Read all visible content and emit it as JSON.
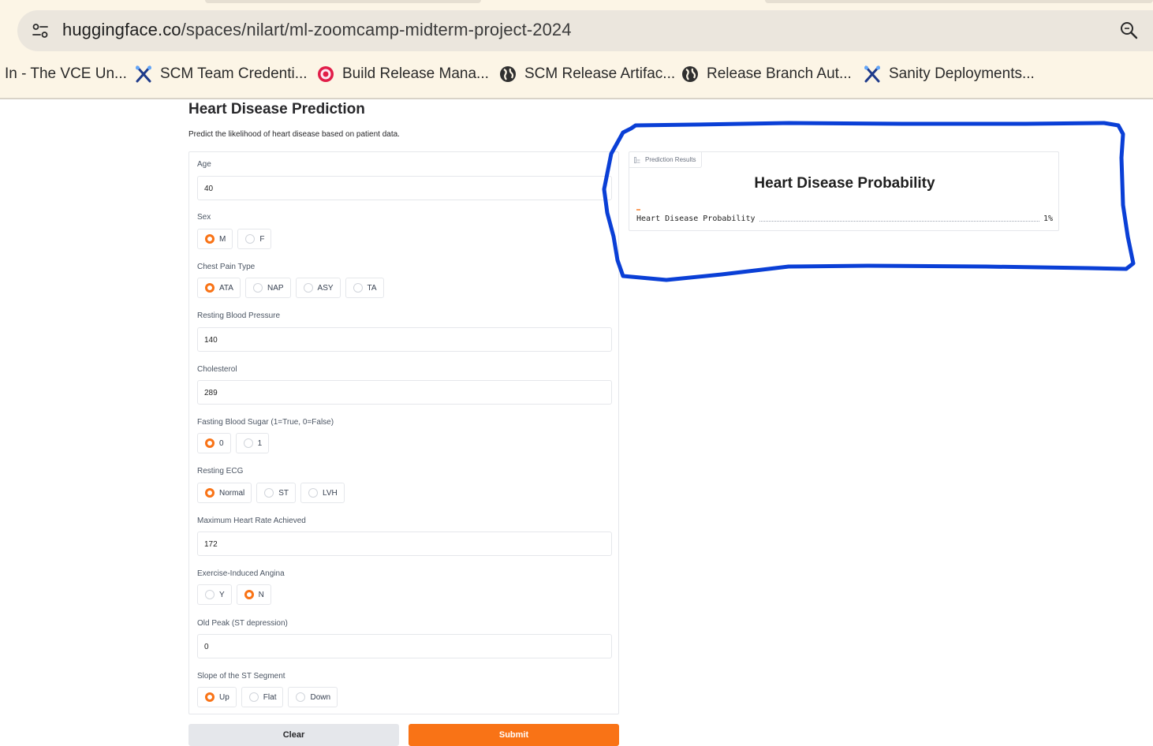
{
  "browser": {
    "url_host": "huggingface.co",
    "url_path": "/spaces/nilart/ml-zoomcamp-midterm-project-2024",
    "bookmarks": [
      {
        "label": "In - The VCE Un...",
        "icon": "none"
      },
      {
        "label": "SCM Team Credenti...",
        "icon": "crossed-tools-icon"
      },
      {
        "label": "Build Release Mana...",
        "icon": "lifebuoy-icon"
      },
      {
        "label": "SCM Release Artifac...",
        "icon": "globe-icon"
      },
      {
        "label": "Release Branch Aut...",
        "icon": "globe-icon"
      },
      {
        "label": "Sanity Deployments...",
        "icon": "crossed-tools-icon"
      }
    ]
  },
  "page": {
    "title": "Heart Disease Prediction",
    "description": "Predict the likelihood of heart disease based on patient data."
  },
  "form": {
    "age": {
      "label": "Age",
      "value": "40"
    },
    "sex": {
      "label": "Sex",
      "options": [
        "M",
        "F"
      ],
      "selected": "M"
    },
    "chest_pain": {
      "label": "Chest Pain Type",
      "options": [
        "ATA",
        "NAP",
        "ASY",
        "TA"
      ],
      "selected": "ATA"
    },
    "resting_bp": {
      "label": "Resting Blood Pressure",
      "value": "140"
    },
    "cholesterol": {
      "label": "Cholesterol",
      "value": "289"
    },
    "fasting_bs": {
      "label": "Fasting Blood Sugar (1=True, 0=False)",
      "options": [
        "0",
        "1"
      ],
      "selected": "0"
    },
    "resting_ecg": {
      "label": "Resting ECG",
      "options": [
        "Normal",
        "ST",
        "LVH"
      ],
      "selected": "Normal"
    },
    "max_hr": {
      "label": "Maximum Heart Rate Achieved",
      "value": "172"
    },
    "exercise_angina": {
      "label": "Exercise-Induced Angina",
      "options": [
        "Y",
        "N"
      ],
      "selected": "N"
    },
    "oldpeak": {
      "label": "Old Peak (ST depression)",
      "value": "0"
    },
    "st_slope": {
      "label": "Slope of the ST Segment",
      "options": [
        "Up",
        "Flat",
        "Down"
      ],
      "selected": "Up"
    }
  },
  "buttons": {
    "clear": "Clear",
    "submit": "Submit"
  },
  "output": {
    "panel_label": "Prediction Results",
    "heading": "Heart Disease Probability",
    "row_label": "Heart Disease Probability",
    "row_value": "1%",
    "probability": 0.01
  },
  "colors": {
    "accent": "#f97316",
    "annotation": "#0a3fd6"
  }
}
